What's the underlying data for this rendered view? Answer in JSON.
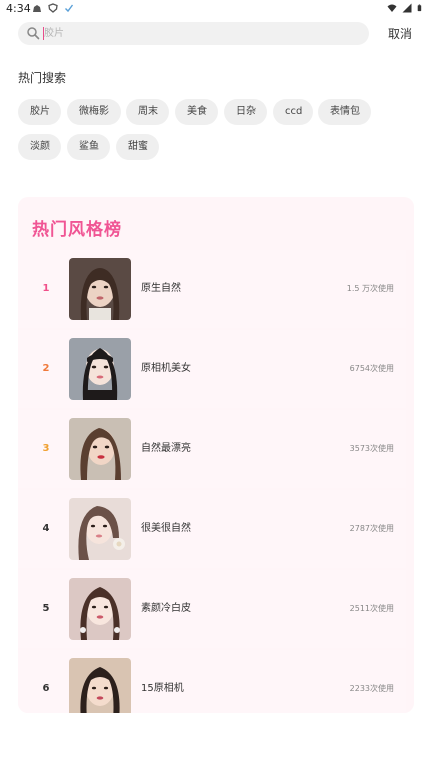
{
  "status_bar": {
    "time": "4:34",
    "left_icons": [
      "notification-icon",
      "shield-icon",
      "check-icon"
    ],
    "right_icons": [
      "wifi-icon",
      "signal-icon",
      "battery-icon"
    ]
  },
  "search": {
    "placeholder": "胶片",
    "value": "",
    "cancel_label": "取消"
  },
  "hot_search": {
    "title": "热门搜索",
    "tags": [
      "胶片",
      "微梅影",
      "周末",
      "美食",
      "日杂",
      "ccd",
      "表情包",
      "淡颜",
      "鲨鱼",
      "甜蜜"
    ]
  },
  "ranking": {
    "title": "热门风格榜",
    "items": [
      {
        "rank": "1",
        "name": "原生自然",
        "uses": "1.5 万次使用",
        "rank_color": "#f0508a"
      },
      {
        "rank": "2",
        "name": "原相机美女",
        "uses": "6754次使用",
        "rank_color": "#f07a3c"
      },
      {
        "rank": "3",
        "name": "自然最漂亮",
        "uses": "3573次使用",
        "rank_color": "#f0a030"
      },
      {
        "rank": "4",
        "name": "很美很自然",
        "uses": "2787次使用",
        "rank_color": "#333333"
      },
      {
        "rank": "5",
        "name": "素颜冷白皮",
        "uses": "2511次使用",
        "rank_color": "#333333"
      },
      {
        "rank": "6",
        "name": "15原相机",
        "uses": "2233次使用",
        "rank_color": "#333333"
      }
    ]
  },
  "colors": {
    "accent": "#f05594",
    "card_bg": "#fff5f8",
    "chip_bg": "#efefef"
  }
}
